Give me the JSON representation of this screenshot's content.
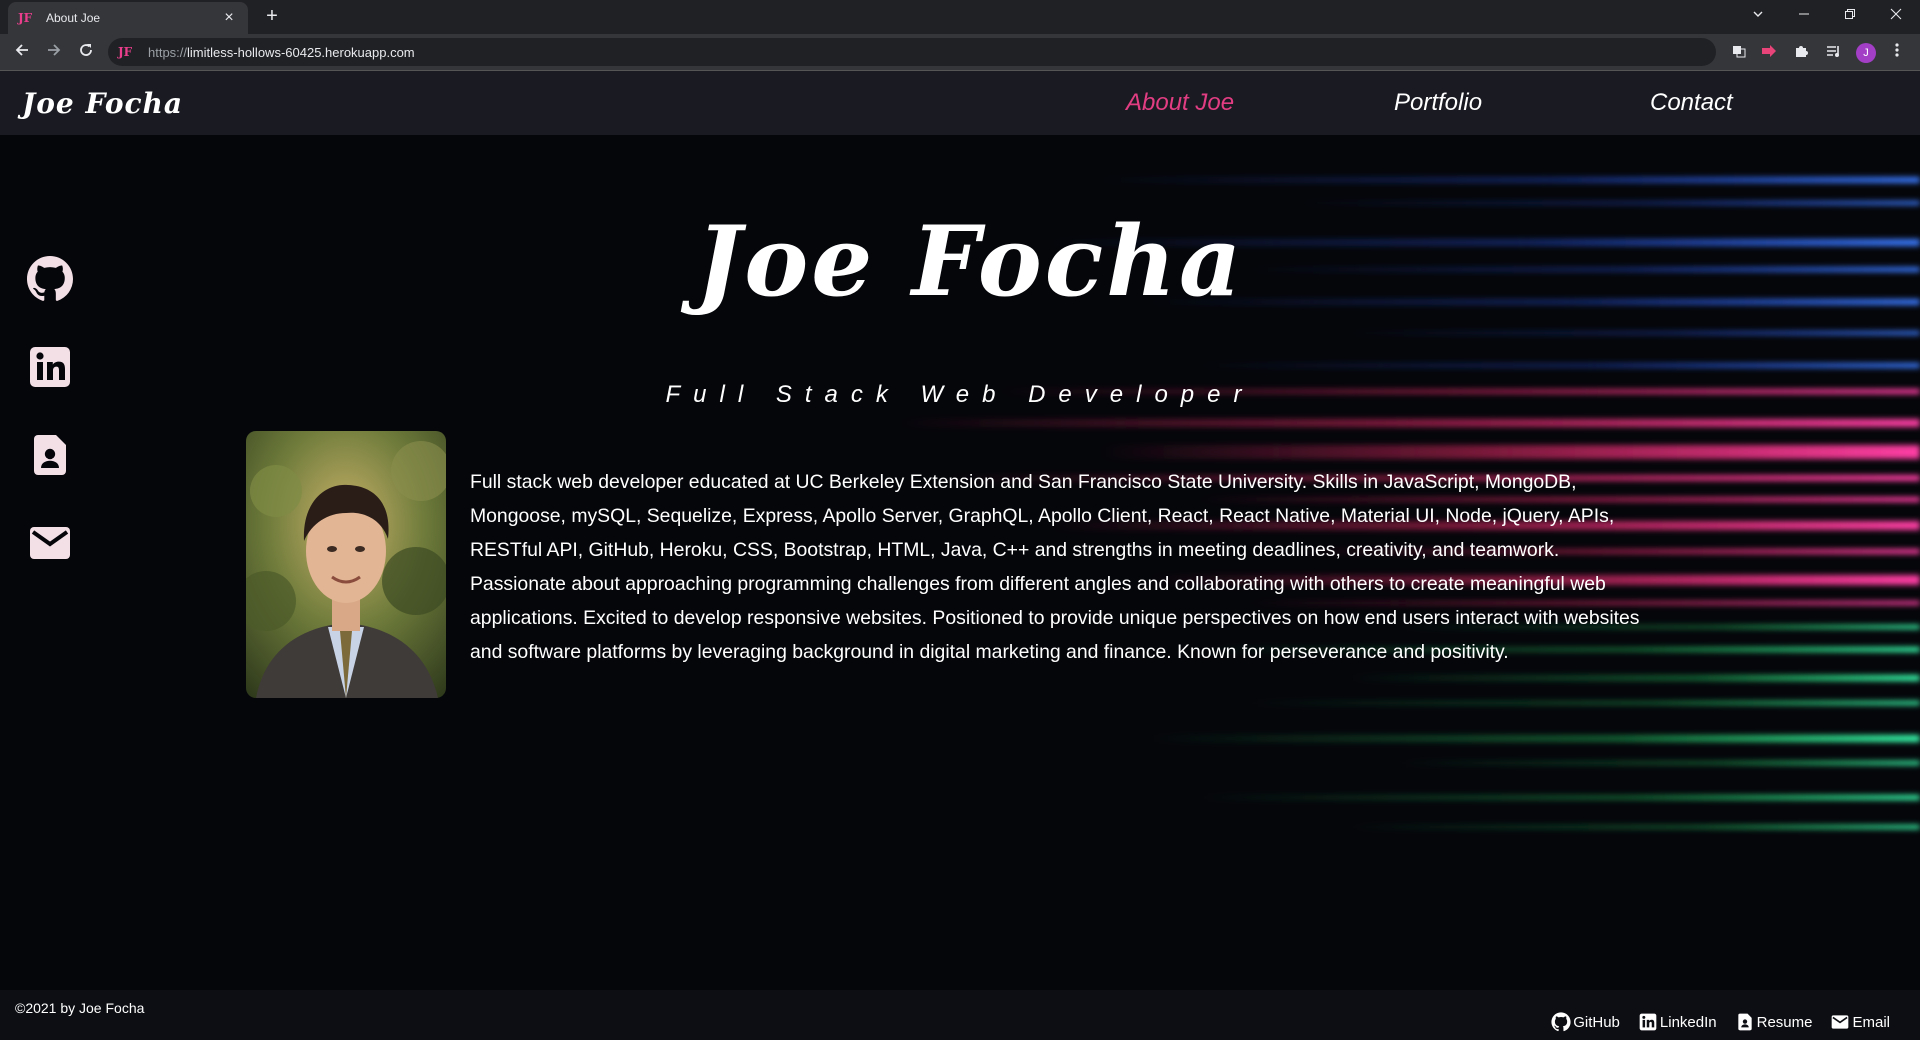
{
  "browser": {
    "tab_title": "About Joe",
    "favicon_text": "JF",
    "close_glyph": "×",
    "new_tab_glyph": "+",
    "url_scheme": "https://",
    "url_host": "limitless-hollows-60425.herokuapp.com",
    "profile_initial": "J"
  },
  "nav": {
    "brand": "Joe Focha",
    "links": [
      "About Joe",
      "Portfolio",
      "Contact"
    ],
    "active_color": "#e23d83"
  },
  "hero": {
    "title": "Joe Focha",
    "subtitle": "Full Stack Web Developer"
  },
  "social": [
    {
      "icon": "github-icon",
      "label": "GitHub"
    },
    {
      "icon": "linkedin-icon",
      "label": "LinkedIn"
    },
    {
      "icon": "resume-icon",
      "label": "Resume"
    },
    {
      "icon": "email-icon",
      "label": "Email"
    }
  ],
  "bio": "Full stack web developer educated at UC Berkeley Extension and San Francisco State University. Skills in JavaScript, MongoDB, Mongoose, mySQL, Sequelize, Express, Apollo Server, GraphQL, Apollo Client, React, React Native, Material UI, Node, jQuery, APIs, RESTful API, GitHub, Heroku, CSS, Bootstrap, HTML, Java, C++ and strengths in meeting deadlines, creativity, and teamwork. Passionate about approaching programming challenges from different angles and collaborating with others to create meaningful web applications. Excited to develop responsive websites. Positioned to provide unique perspectives on how end users interact with websites and software platforms by leveraging background in digital marketing and finance. Known for perseverance and positivity.",
  "footer": {
    "copyright": "©2021 by Joe Focha",
    "links": [
      "GitHub",
      "LinkedIn",
      "Resume",
      "Email"
    ]
  },
  "colors": {
    "accent_pink": "#e23d83",
    "streak_blue": "#2a5cff",
    "streak_pink": "#ff2d6f",
    "streak_green": "#2bff7a"
  }
}
